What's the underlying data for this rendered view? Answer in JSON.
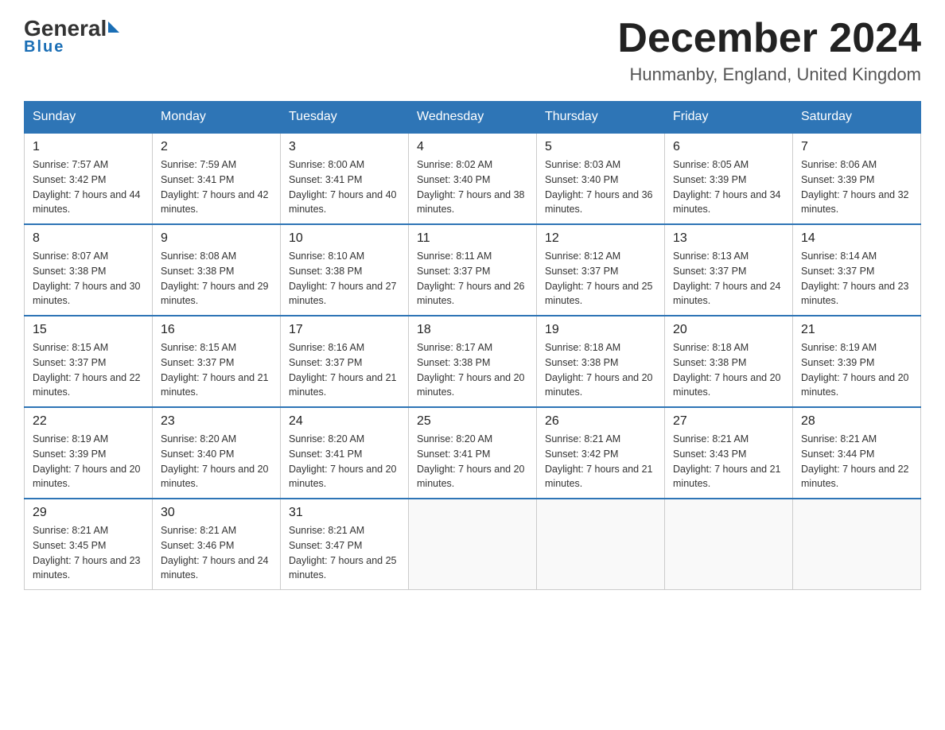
{
  "header": {
    "logo_general": "General",
    "logo_blue": "Blue",
    "month_title": "December 2024",
    "location": "Hunmanby, England, United Kingdom"
  },
  "weekdays": [
    "Sunday",
    "Monday",
    "Tuesday",
    "Wednesday",
    "Thursday",
    "Friday",
    "Saturday"
  ],
  "weeks": [
    [
      {
        "day": "1",
        "sunrise": "7:57 AM",
        "sunset": "3:42 PM",
        "daylight": "7 hours and 44 minutes."
      },
      {
        "day": "2",
        "sunrise": "7:59 AM",
        "sunset": "3:41 PM",
        "daylight": "7 hours and 42 minutes."
      },
      {
        "day": "3",
        "sunrise": "8:00 AM",
        "sunset": "3:41 PM",
        "daylight": "7 hours and 40 minutes."
      },
      {
        "day": "4",
        "sunrise": "8:02 AM",
        "sunset": "3:40 PM",
        "daylight": "7 hours and 38 minutes."
      },
      {
        "day": "5",
        "sunrise": "8:03 AM",
        "sunset": "3:40 PM",
        "daylight": "7 hours and 36 minutes."
      },
      {
        "day": "6",
        "sunrise": "8:05 AM",
        "sunset": "3:39 PM",
        "daylight": "7 hours and 34 minutes."
      },
      {
        "day": "7",
        "sunrise": "8:06 AM",
        "sunset": "3:39 PM",
        "daylight": "7 hours and 32 minutes."
      }
    ],
    [
      {
        "day": "8",
        "sunrise": "8:07 AM",
        "sunset": "3:38 PM",
        "daylight": "7 hours and 30 minutes."
      },
      {
        "day": "9",
        "sunrise": "8:08 AM",
        "sunset": "3:38 PM",
        "daylight": "7 hours and 29 minutes."
      },
      {
        "day": "10",
        "sunrise": "8:10 AM",
        "sunset": "3:38 PM",
        "daylight": "7 hours and 27 minutes."
      },
      {
        "day": "11",
        "sunrise": "8:11 AM",
        "sunset": "3:37 PM",
        "daylight": "7 hours and 26 minutes."
      },
      {
        "day": "12",
        "sunrise": "8:12 AM",
        "sunset": "3:37 PM",
        "daylight": "7 hours and 25 minutes."
      },
      {
        "day": "13",
        "sunrise": "8:13 AM",
        "sunset": "3:37 PM",
        "daylight": "7 hours and 24 minutes."
      },
      {
        "day": "14",
        "sunrise": "8:14 AM",
        "sunset": "3:37 PM",
        "daylight": "7 hours and 23 minutes."
      }
    ],
    [
      {
        "day": "15",
        "sunrise": "8:15 AM",
        "sunset": "3:37 PM",
        "daylight": "7 hours and 22 minutes."
      },
      {
        "day": "16",
        "sunrise": "8:15 AM",
        "sunset": "3:37 PM",
        "daylight": "7 hours and 21 minutes."
      },
      {
        "day": "17",
        "sunrise": "8:16 AM",
        "sunset": "3:37 PM",
        "daylight": "7 hours and 21 minutes."
      },
      {
        "day": "18",
        "sunrise": "8:17 AM",
        "sunset": "3:38 PM",
        "daylight": "7 hours and 20 minutes."
      },
      {
        "day": "19",
        "sunrise": "8:18 AM",
        "sunset": "3:38 PM",
        "daylight": "7 hours and 20 minutes."
      },
      {
        "day": "20",
        "sunrise": "8:18 AM",
        "sunset": "3:38 PM",
        "daylight": "7 hours and 20 minutes."
      },
      {
        "day": "21",
        "sunrise": "8:19 AM",
        "sunset": "3:39 PM",
        "daylight": "7 hours and 20 minutes."
      }
    ],
    [
      {
        "day": "22",
        "sunrise": "8:19 AM",
        "sunset": "3:39 PM",
        "daylight": "7 hours and 20 minutes."
      },
      {
        "day": "23",
        "sunrise": "8:20 AM",
        "sunset": "3:40 PM",
        "daylight": "7 hours and 20 minutes."
      },
      {
        "day": "24",
        "sunrise": "8:20 AM",
        "sunset": "3:41 PM",
        "daylight": "7 hours and 20 minutes."
      },
      {
        "day": "25",
        "sunrise": "8:20 AM",
        "sunset": "3:41 PM",
        "daylight": "7 hours and 20 minutes."
      },
      {
        "day": "26",
        "sunrise": "8:21 AM",
        "sunset": "3:42 PM",
        "daylight": "7 hours and 21 minutes."
      },
      {
        "day": "27",
        "sunrise": "8:21 AM",
        "sunset": "3:43 PM",
        "daylight": "7 hours and 21 minutes."
      },
      {
        "day": "28",
        "sunrise": "8:21 AM",
        "sunset": "3:44 PM",
        "daylight": "7 hours and 22 minutes."
      }
    ],
    [
      {
        "day": "29",
        "sunrise": "8:21 AM",
        "sunset": "3:45 PM",
        "daylight": "7 hours and 23 minutes."
      },
      {
        "day": "30",
        "sunrise": "8:21 AM",
        "sunset": "3:46 PM",
        "daylight": "7 hours and 24 minutes."
      },
      {
        "day": "31",
        "sunrise": "8:21 AM",
        "sunset": "3:47 PM",
        "daylight": "7 hours and 25 minutes."
      },
      null,
      null,
      null,
      null
    ]
  ]
}
